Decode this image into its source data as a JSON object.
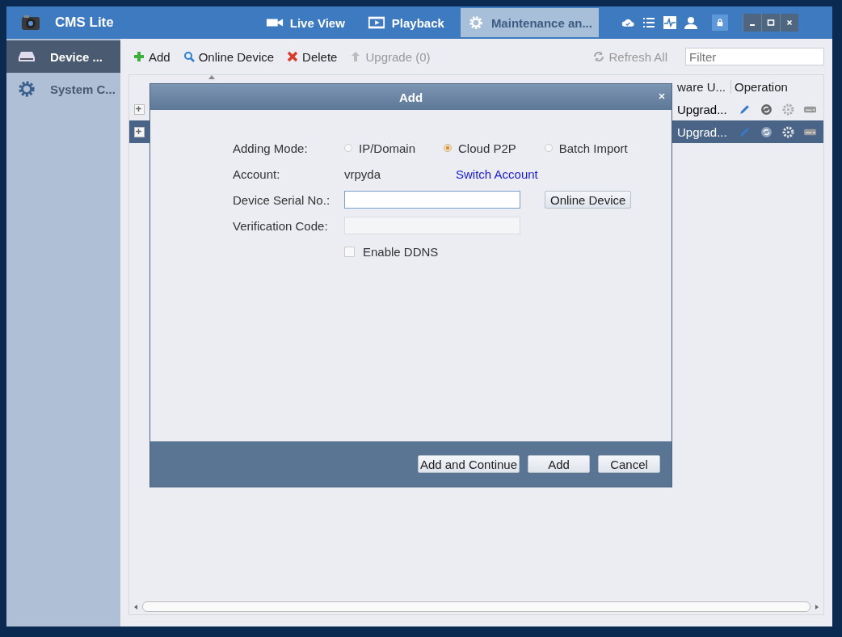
{
  "app": {
    "title": "CMS Lite"
  },
  "nav_tabs": [
    {
      "label": "Live View",
      "kind": "camera",
      "selected": false
    },
    {
      "label": "Playback",
      "kind": "film",
      "selected": false
    },
    {
      "label": "Maintenance an...",
      "kind": "gear",
      "selected": true
    }
  ],
  "sidebar": {
    "items": [
      {
        "label": "Device ...",
        "kind": "device",
        "selected": true
      },
      {
        "label": "System C...",
        "kind": "gear",
        "selected": false
      }
    ]
  },
  "toolbar": {
    "buttons": [
      {
        "label": "Add",
        "kind": "add",
        "disabled": false
      },
      {
        "label": "Online Device",
        "kind": "search",
        "disabled": false
      },
      {
        "label": "Delete",
        "kind": "delete",
        "disabled": false
      },
      {
        "label": "Upgrade (0)",
        "kind": "upgrade",
        "disabled": true
      }
    ],
    "refresh": "Refresh All",
    "filter": {
      "placeholder": "Filter"
    }
  },
  "table": {
    "columns": [
      "ware U...",
      "Operation"
    ],
    "rows": [
      {
        "firmware": "Upgrad...",
        "selected": false
      },
      {
        "firmware": "Upgrad...",
        "selected": true
      }
    ]
  },
  "dialog": {
    "title": "Add",
    "adding_mode_label": "Adding Mode:",
    "modes": [
      {
        "label": "IP/Domain",
        "selected": false
      },
      {
        "label": "Cloud P2P",
        "selected": true
      },
      {
        "label": "Batch Import",
        "selected": false
      }
    ],
    "account_label": "Account:",
    "account": "vrpyda",
    "switch_account": "Switch Account",
    "serial_label": "Device Serial No.:",
    "online_device": "Online Device",
    "verification_label": "Verification Code:",
    "enable_ddns": {
      "label": "Enable DDNS",
      "checked": false
    },
    "buttons": [
      "Add and Continue",
      "Add",
      "Cancel"
    ]
  }
}
